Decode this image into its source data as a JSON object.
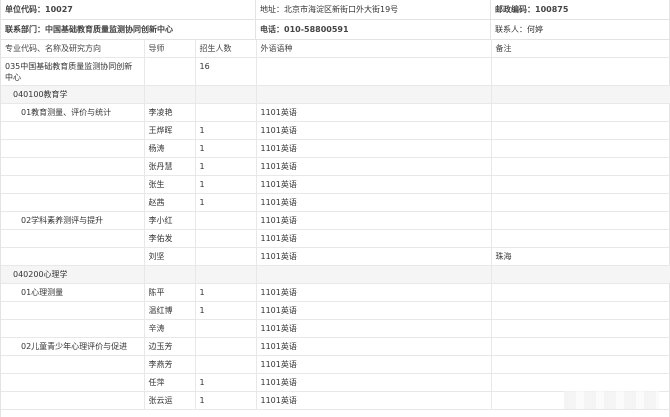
{
  "header": {
    "unit_code": "单位代码：10027",
    "address": "地址：北京市海淀区新街口外大街19号",
    "postcode": "邮政编码：100875",
    "department": "联系部门：中国基础教育质量监测协同创新中心",
    "phone": "电话：010-58800591",
    "contact": "联系人：何婷"
  },
  "table": {
    "columns": [
      "专业代码、名称及研究方向",
      "导师",
      "招生人数",
      "外语语种",
      "备注"
    ],
    "dept": {
      "name": "035中国基础教育质量监测协同创新中心",
      "quota": "16"
    },
    "majors": [
      {
        "name": "040100教育学",
        "directions": [
          {
            "name": "01教育测量、评价与统计",
            "rows": [
              {
                "tutor": "李凌艳",
                "quota": "",
                "lang": "1101英语",
                "note": ""
              },
              {
                "tutor": "王烨晖",
                "quota": "1",
                "lang": "1101英语",
                "note": ""
              },
              {
                "tutor": "杨涛",
                "quota": "1",
                "lang": "1101英语",
                "note": ""
              },
              {
                "tutor": "张丹慧",
                "quota": "1",
                "lang": "1101英语",
                "note": ""
              },
              {
                "tutor": "张生",
                "quota": "1",
                "lang": "1101英语",
                "note": ""
              },
              {
                "tutor": "赵茜",
                "quota": "1",
                "lang": "1101英语",
                "note": ""
              }
            ]
          },
          {
            "name": "02学科素养测评与提升",
            "rows": [
              {
                "tutor": "李小红",
                "quota": "",
                "lang": "1101英语",
                "note": ""
              },
              {
                "tutor": "李佑发",
                "quota": "",
                "lang": "1101英语",
                "note": ""
              },
              {
                "tutor": "刘坚",
                "quota": "",
                "lang": "1101英语",
                "note": "珠海"
              }
            ]
          }
        ]
      },
      {
        "name": "040200心理学",
        "directions": [
          {
            "name": "01心理测量",
            "rows": [
              {
                "tutor": "陈平",
                "quota": "1",
                "lang": "1101英语",
                "note": ""
              },
              {
                "tutor": "温红博",
                "quota": "1",
                "lang": "1101英语",
                "note": ""
              },
              {
                "tutor": "辛涛",
                "quota": "",
                "lang": "1101英语",
                "note": ""
              }
            ]
          },
          {
            "name": "02儿童青少年心理评价与促进",
            "rows": [
              {
                "tutor": "边玉芳",
                "quota": "",
                "lang": "1101英语",
                "note": ""
              },
              {
                "tutor": "李燕芳",
                "quota": "",
                "lang": "1101英语",
                "note": ""
              },
              {
                "tutor": "任萍",
                "quota": "1",
                "lang": "1101英语",
                "note": ""
              },
              {
                "tutor": "张云运",
                "quota": "1",
                "lang": "1101英语",
                "note": ""
              }
            ]
          }
        ]
      }
    ]
  }
}
